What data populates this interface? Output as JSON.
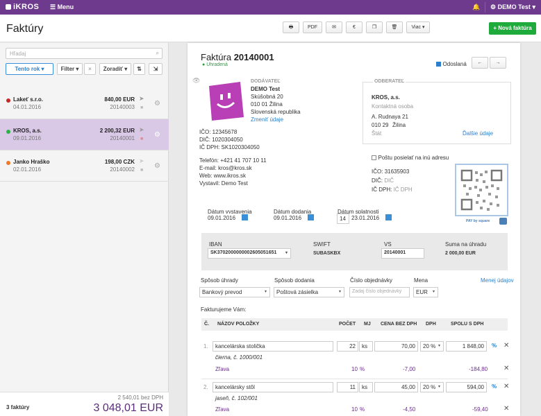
{
  "topbar": {
    "logo": "iKROS",
    "menu": "Menu",
    "user": "DEMO Test"
  },
  "header": {
    "title": "Faktúry",
    "pdf": "PDF",
    "euro": "€",
    "more": "Viac",
    "new_invoice": "Nová faktúra"
  },
  "sidebar": {
    "search_placeholder": "Hľadaj",
    "filter_year": "Tento rok",
    "filter": "Filter",
    "sort": "Zoradiť",
    "invoices": [
      {
        "name": "Lakeť s.r.o.",
        "date": "04.01.2016",
        "amount": "840,00 EUR",
        "number": "20140003",
        "dot_color": "#c62828"
      },
      {
        "name": "KROS, a.s.",
        "date": "09.01.2016",
        "amount": "2 200,32 EUR",
        "number": "20140001",
        "dot_color": "#2db24a"
      },
      {
        "name": "Janko Hraško",
        "date": "02.01.2016",
        "amount": "198,00 CZK",
        "number": "20140002",
        "dot_color": "#ee7a2a"
      }
    ],
    "footer": {
      "count": "3 faktúry",
      "net": "2 540,01 bez DPH",
      "total": "3 048,01 EUR"
    }
  },
  "invoice": {
    "title_prefix": "Faktúra",
    "number": "20140001",
    "status": "Uhradená",
    "sent_label": "Odoslaná",
    "supplier": {
      "heading": "DODÁVATEĽ",
      "name": "DEMO Test",
      "street": "Skúšobná 20",
      "city": "010 01 Žilina",
      "country": "Slovenská republika",
      "change_link": "Zmeniť údaje",
      "ico": "IČO: 12345678",
      "dic": "DIČ: 1020304050",
      "icdph": "IČ DPH: SK1020304050",
      "phone": "Telefón: +421 41 707 10 11",
      "email": "E-mail: kros@kros.sk",
      "web": "Web: www.ikros.sk",
      "issued_by": "Vystavil: Demo Test"
    },
    "customer": {
      "heading": "ODBERATEĽ",
      "name": "KROS, a.s.",
      "contact_placeholder": "Kontaktná osoba",
      "street": "A. Rudnaya 21",
      "zip": "010 29",
      "city": "Žilina",
      "state_placeholder": "Štát",
      "more_link": "Ďalšie údaje",
      "post_other": "Poštu posielať na inú adresu",
      "ico_label": "IČO:",
      "ico": "31635903",
      "dic_label": "DIČ:",
      "dic_placeholder": "DIČ",
      "icdph_label": "IČ DPH:",
      "icdph_placeholder": "IČ DPH"
    },
    "paybysquare": "PAY by square",
    "dates": {
      "issued_label": "Dátum vystavenia",
      "issued": "09.01.2016",
      "delivery_label": "Dátum dodania",
      "delivery": "09.01.2016",
      "due_label": "Dátum splatnosti",
      "due_days": "14",
      "due": "23.01.2016"
    },
    "payment": {
      "iban_label": "IBAN",
      "iban": "SK3702000000002605051651",
      "swift_label": "SWIFT",
      "swift": "SUBASKBX",
      "vs_label": "VS",
      "vs": "20140001",
      "sum_label": "Suma na úhradu",
      "sum": "2 000,00 EUR"
    },
    "options": {
      "pay_method_label": "Spôsob úhrady",
      "pay_method": "Bankový prevod",
      "delivery_method_label": "Spôsob dodania",
      "delivery_method": "Poštová zásielka",
      "order_label": "Číslo objednávky",
      "order_placeholder": "Zadaj číslo objednávky",
      "currency_label": "Mena",
      "currency": "EUR",
      "less_link": "Menej údajov"
    },
    "billing_text": "Fakturujeme Vám:",
    "table_headers": {
      "no": "Č.",
      "name": "NÁZOV POLOŽKY",
      "qty": "POČET",
      "unit": "MJ",
      "price": "CENA BEZ DPH",
      "vat": "DPH",
      "total": "SPOLU S DPH"
    },
    "items": [
      {
        "no": "1.",
        "name": "kancelárska stolička",
        "desc": "čierna, č. 1000/001",
        "qty": "22",
        "unit": "ks",
        "price": "70,00",
        "vat": "20 %",
        "total": "1 848,00",
        "discount_label": "Zľava",
        "discount_qty": "10",
        "discount_unit": "%",
        "discount_price": "-7,00",
        "discount_total": "-184,80"
      },
      {
        "no": "2.",
        "name": "kancelársky stôl",
        "desc": "jaseň, č. 102/001",
        "qty": "11",
        "unit": "ks",
        "price": "45,00",
        "vat": "20 %",
        "total": "594,00",
        "discount_label": "Zľava",
        "discount_qty": "10",
        "discount_unit": "%",
        "discount_price": "-4,50",
        "discount_total": "-59,40"
      }
    ]
  }
}
